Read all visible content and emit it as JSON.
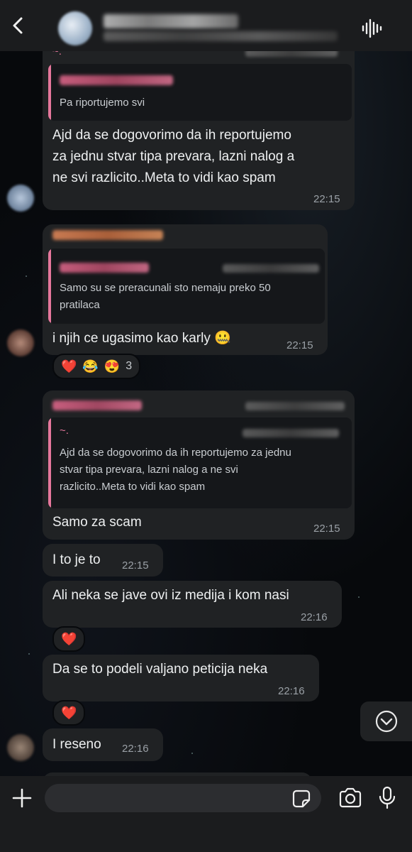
{
  "header": {
    "back_icon": "chevron-left-icon",
    "audio_icon": "audio-waveform-icon"
  },
  "messages": [
    {
      "sender_prefix": "~.",
      "quote_text": "Pa riportujemo svi",
      "text": "Ajd da se dogovorimo da ih reportujemo\nza jednu stvar tipa prevara, lazni nalog a\nne svi razlicito..Meta to vidi kao spam",
      "time": "22:15"
    },
    {
      "quote_text": "Samo su se preracunali sto nemaju preko 50\npratilaca",
      "text": "i njih ce ugasimo kao karly 🤐",
      "time": "22:15",
      "reactions": [
        "❤️",
        "😂",
        "😍"
      ],
      "reaction_count": "3"
    },
    {
      "quote_sender_prefix": "~.",
      "quote_text": "Ajd da se dogovorimo da ih reportujemo za jednu\nstvar tipa prevara, lazni nalog a ne svi\nrazlicito..Meta to vidi kao spam",
      "text": "Samo za scam",
      "time": "22:15"
    },
    {
      "text": "I to je to",
      "time": "22:15"
    },
    {
      "text": "Ali neka se jave ovi iz medija i kom nasi",
      "time": "22:16",
      "reactions": [
        "❤️"
      ]
    },
    {
      "text": "Da se to podeli valjano peticija neka",
      "time": "22:16",
      "reactions": [
        "❤️"
      ]
    },
    {
      "text": "I reseno",
      "time": "22:16"
    }
  ],
  "input": {
    "placeholder": "",
    "plus_icon": "plus-icon",
    "sticker_icon": "sticker-icon",
    "camera_icon": "camera-icon",
    "mic_icon": "microphone-icon"
  },
  "scroll_down_icon": "chevron-down-circle-icon"
}
